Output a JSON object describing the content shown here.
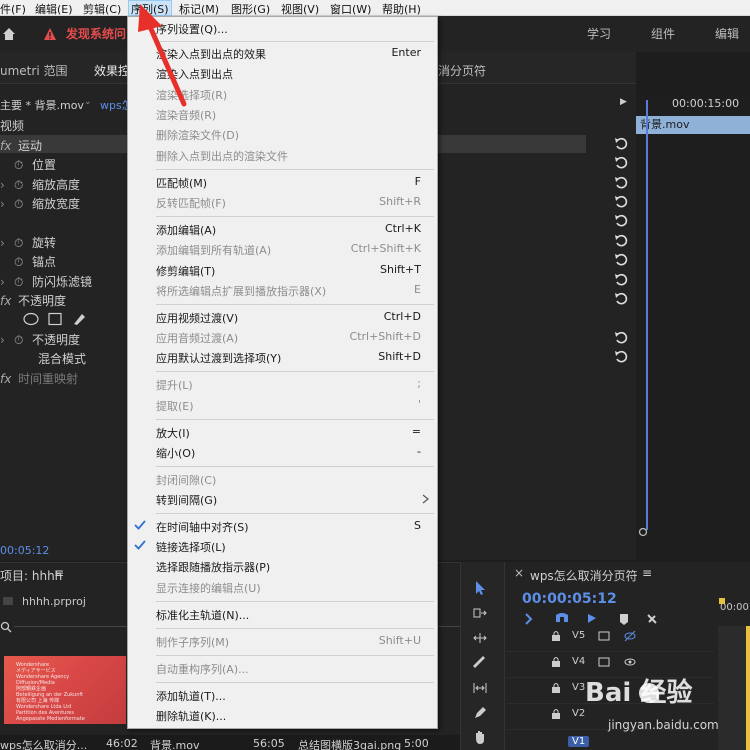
{
  "menubar": {
    "items": [
      "件(F)",
      "编辑(E)",
      "剪辑(C)",
      "序列(S)",
      "标记(M)",
      "图形(G)",
      "视图(V)",
      "窗口(W)",
      "帮助(H)"
    ],
    "active_index": 3
  },
  "header": {
    "warning_text": "发现系统问",
    "workspace_tabs": [
      "学习",
      "组件",
      "编辑"
    ]
  },
  "effect_controls": {
    "tabs": [
      "umetri 范围",
      "效果控",
      "消分页符"
    ],
    "source_clip": "主要 * 背景.mov",
    "sequence_clip": "wps怎",
    "section_video": "视频",
    "properties": [
      {
        "label": "运动",
        "kind": "fx",
        "highlight": true
      },
      {
        "label": "位置",
        "kind": "stopwatch"
      },
      {
        "label": "缩放高度",
        "kind": "chevron"
      },
      {
        "label": "缩放宽度",
        "kind": "chevron"
      },
      {
        "label": "旋转",
        "kind": "chevron"
      },
      {
        "label": "锚点",
        "kind": "stopwatch"
      },
      {
        "label": "防闪烁滤镜",
        "kind": "chevron"
      },
      {
        "label": "不透明度",
        "kind": "fx"
      },
      {
        "label": "不透明度",
        "kind": "chevron"
      },
      {
        "label": "混合模式",
        "kind": "plain"
      },
      {
        "label": "时间重映射",
        "kind": "fx-dim"
      }
    ],
    "mini_timeline_time": "00:00:15:00",
    "mini_clip_label": "背景.mov",
    "current_timecode": "00:05:12"
  },
  "project_panel": {
    "title": "项目: hhhh",
    "file": "hhhh.prproj",
    "bottom_items": [
      {
        "name": "wps怎么取消分...",
        "duration": "46:02"
      },
      {
        "name": "背景.mov",
        "duration": "56:05"
      },
      {
        "name": "总结图横版3gai.png",
        "duration": "5:00"
      }
    ],
    "thumbnail_text": [
      "Wondershare",
      "メディアサービス",
      "Wondershare Agency",
      "Diffusion/Media",
      "阿部鋼鉄企画",
      "Beteiligung an der Zukunft",
      "有限公司 上海 传媒",
      "Wondershare Ltda Ltd",
      "Partition des Aventures",
      "Angepasste Medienformate",
      "Wondershare Agenzia"
    ]
  },
  "sequence_panel": {
    "title": "wps怎么取消分页符",
    "timecode": "00:00:05:12",
    "ruler_time": "00:00",
    "tracks": [
      "V5",
      "V4",
      "V3",
      "V2",
      "V1"
    ]
  },
  "watermark": {
    "brand_text": "Bai 经验",
    "url": "jingyan.baidu.com"
  },
  "sequence_menu": {
    "items": [
      {
        "label": "序列设置(Q)...",
        "shortcut": "",
        "disabled": false
      },
      {
        "label": "渲染入点到出点的效果",
        "shortcut": "Enter",
        "disabled": false
      },
      {
        "label": "渲染入点到出点",
        "shortcut": "",
        "disabled": false
      },
      {
        "label": "渲染选择项(R)",
        "shortcut": "",
        "disabled": true
      },
      {
        "label": "渲染音频(R)",
        "shortcut": "",
        "disabled": true
      },
      {
        "label": "删除渲染文件(D)",
        "shortcut": "",
        "disabled": true
      },
      {
        "label": "删除入点到出点的渲染文件",
        "shortcut": "",
        "disabled": true
      },
      {
        "label": "匹配帧(M)",
        "shortcut": "F",
        "disabled": false
      },
      {
        "label": "反转匹配帧(F)",
        "shortcut": "Shift+R",
        "disabled": true
      },
      {
        "label": "添加编辑(A)",
        "shortcut": "Ctrl+K",
        "disabled": false
      },
      {
        "label": "添加编辑到所有轨道(A)",
        "shortcut": "Ctrl+Shift+K",
        "disabled": true
      },
      {
        "label": "修剪编辑(T)",
        "shortcut": "Shift+T",
        "disabled": false
      },
      {
        "label": "将所选编辑点扩展到播放指示器(X)",
        "shortcut": "E",
        "disabled": true
      },
      {
        "label": "应用视频过渡(V)",
        "shortcut": "Ctrl+D",
        "disabled": false
      },
      {
        "label": "应用音频过渡(A)",
        "shortcut": "Ctrl+Shift+D",
        "disabled": true
      },
      {
        "label": "应用默认过渡到选择项(Y)",
        "shortcut": "Shift+D",
        "disabled": false
      },
      {
        "label": "提升(L)",
        "shortcut": ";",
        "disabled": true
      },
      {
        "label": "提取(E)",
        "shortcut": "'",
        "disabled": true
      },
      {
        "label": "放大(I)",
        "shortcut": "=",
        "disabled": false
      },
      {
        "label": "缩小(O)",
        "shortcut": "-",
        "disabled": false
      },
      {
        "label": "封闭间隙(C)",
        "shortcut": "",
        "disabled": true
      },
      {
        "label": "转到间隔(G)",
        "shortcut": "",
        "disabled": false,
        "submenu": true
      },
      {
        "label": "在时间轴中对齐(S)",
        "shortcut": "S",
        "disabled": false,
        "checked": true
      },
      {
        "label": "链接选择项(L)",
        "shortcut": "",
        "disabled": false,
        "checked": true
      },
      {
        "label": "选择跟随播放指示器(P)",
        "shortcut": "",
        "disabled": false
      },
      {
        "label": "显示连接的编辑点(U)",
        "shortcut": "",
        "disabled": true
      },
      {
        "label": "标准化主轨道(N)...",
        "shortcut": "",
        "disabled": false
      },
      {
        "label": "制作子序列(M)",
        "shortcut": "Shift+U",
        "disabled": true
      },
      {
        "label": "自动重构序列(A)...",
        "shortcut": "",
        "disabled": true
      },
      {
        "label": "添加轨道(T)...",
        "shortcut": "",
        "disabled": false
      },
      {
        "label": "删除轨道(K)...",
        "shortcut": "",
        "disabled": false
      }
    ]
  },
  "colors": {
    "accent_blue": "#5d8fe8",
    "warning_red": "#e34c4c",
    "annotation_red": "#e8302a",
    "menu_bg": "#f0f0f0"
  }
}
